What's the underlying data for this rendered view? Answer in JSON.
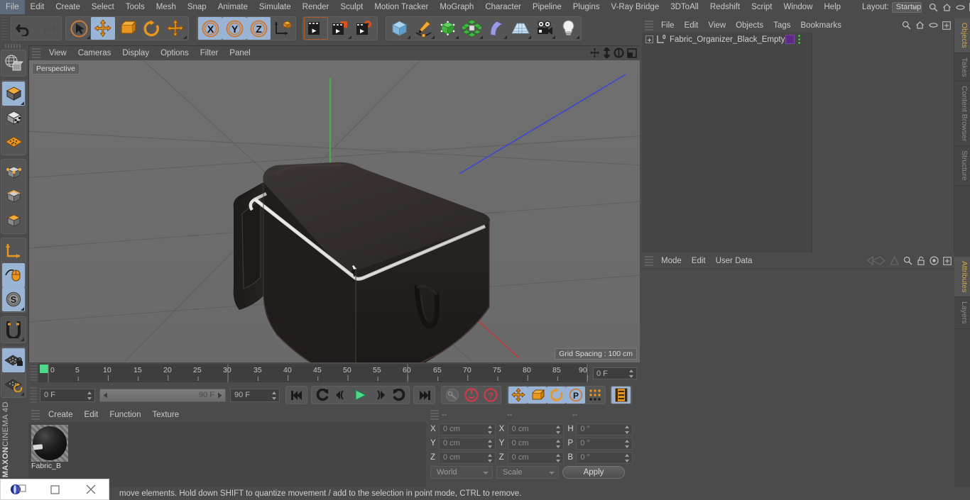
{
  "menubar": {
    "items": [
      "File",
      "Edit",
      "Create",
      "Select",
      "Tools",
      "Mesh",
      "Snap",
      "Animate",
      "Simulate",
      "Render",
      "Sculpt",
      "Motion Tracker",
      "MoGraph",
      "Character",
      "Pipeline",
      "Plugins",
      "V-Ray Bridge",
      "3DToAll",
      "Redshift",
      "Script",
      "Window",
      "Help"
    ],
    "layout_label": "Layout:",
    "layout_value": "Startup"
  },
  "toolbar": {
    "groups": [
      {
        "name": "history",
        "buttons": [
          {
            "name": "undo-button",
            "icon": "undo-icon",
            "active": false
          },
          {
            "name": "redo-button",
            "icon": "redo-icon",
            "active": false
          }
        ]
      },
      {
        "name": "transform",
        "buttons": [
          {
            "name": "live-selection-button",
            "icon": "cursor-select-icon",
            "active": false
          },
          {
            "name": "move-button",
            "icon": "move-icon",
            "active": true
          },
          {
            "name": "scale-button",
            "icon": "scale-icon",
            "active": false
          },
          {
            "name": "rotate-button",
            "icon": "rotate-icon",
            "active": false
          },
          {
            "name": "move-alt-button",
            "icon": "move-icon",
            "active": false
          }
        ]
      },
      {
        "name": "axis-lock",
        "buttons": [
          {
            "name": "axis-x-button",
            "icon": "x-axis-icon",
            "active": true
          },
          {
            "name": "axis-y-button",
            "icon": "y-axis-icon",
            "active": true
          },
          {
            "name": "axis-z-button",
            "icon": "z-axis-icon",
            "active": true
          },
          {
            "name": "world-object-coords-button",
            "icon": "world-coordinate-icon",
            "active": false
          }
        ]
      },
      {
        "name": "render",
        "buttons": [
          {
            "name": "render-view-button",
            "icon": "render-view-icon",
            "active": false
          },
          {
            "name": "render-to-picture-viewer-button",
            "icon": "render-picture-viewer-icon",
            "active": false
          },
          {
            "name": "render-settings-button",
            "icon": "render-settings-icon",
            "active": false
          }
        ]
      },
      {
        "name": "create",
        "buttons": [
          {
            "name": "add-cube-button",
            "icon": "cube-icon",
            "active": false
          },
          {
            "name": "add-spline-button",
            "icon": "pen-spline-icon",
            "active": false
          },
          {
            "name": "nurbs-button",
            "icon": "green-cube-icon",
            "active": false
          },
          {
            "name": "array-button",
            "icon": "green-cluster-icon",
            "active": false
          },
          {
            "name": "bend-deformer-button",
            "icon": "bend-deformer-icon",
            "active": false
          },
          {
            "name": "floor-environment-button",
            "icon": "floor-grid-icon",
            "active": false
          },
          {
            "name": "camera-button",
            "icon": "camera-icon",
            "active": false
          },
          {
            "name": "light-button",
            "icon": "light-bulb-icon",
            "active": false
          }
        ]
      }
    ]
  },
  "left_palette": {
    "groups": [
      {
        "buttons": [
          {
            "name": "undo-view-button",
            "icon": "globe-wire-icon",
            "active": false
          }
        ]
      },
      {
        "buttons": [
          {
            "name": "make-editable-button",
            "icon": "editable-cube-icon",
            "active": true
          },
          {
            "name": "model-mode-button",
            "icon": "checker-cube-icon",
            "active": false
          },
          {
            "name": "texture-mode-button",
            "icon": "texture-grid-icon",
            "active": false
          }
        ]
      },
      {
        "buttons": [
          {
            "name": "points-mode-button",
            "icon": "points-cube-icon",
            "active": false
          },
          {
            "name": "edges-mode-button",
            "icon": "edges-cube-icon",
            "active": false
          },
          {
            "name": "polygons-mode-button",
            "icon": "polygon-cube-icon",
            "active": false
          }
        ]
      },
      {
        "buttons": [
          {
            "name": "axis-mode-button",
            "icon": "axis-arrow-icon",
            "active": false
          },
          {
            "name": "enable-axis-button",
            "icon": "mouse-icon",
            "active": true
          },
          {
            "name": "soft-selection-button",
            "icon": "s-circle-icon",
            "active": true
          }
        ]
      },
      {
        "buttons": [
          {
            "name": "magnet-tool-button",
            "icon": "magnet-icon",
            "active": false
          }
        ]
      },
      {
        "buttons": [
          {
            "name": "lock-workplane-button",
            "icon": "workplane-lock-icon",
            "active": true
          },
          {
            "name": "rotate-workplane-button",
            "icon": "workplane-rotate-icon",
            "active": false
          }
        ]
      }
    ],
    "brand_bold": "MAXON",
    "brand_rest": "CINEMA 4D"
  },
  "viewport": {
    "menu_items": [
      "View",
      "Cameras",
      "Display",
      "Options",
      "Filter",
      "Panel"
    ],
    "corner_icons": [
      "pan-view-icon",
      "dolly-view-icon",
      "rotate-view-icon",
      "maximize-view-icon"
    ],
    "label": "Perspective",
    "grid_spacing": "Grid Spacing : 100 cm",
    "axis_gizmo": {
      "x": "X",
      "y": "Y",
      "z": "Z",
      "x_color": "#d44040",
      "y_color": "#4fc24f",
      "z_color": "#4a6fe0"
    },
    "scene_object": "fabric organizer black empty storage box"
  },
  "timeline": {
    "ticks": [
      "0",
      "5",
      "10",
      "15",
      "20",
      "25",
      "30",
      "35",
      "40",
      "45",
      "50",
      "55",
      "60",
      "65",
      "70",
      "75",
      "80",
      "85",
      "90"
    ],
    "start": 0,
    "end": 90,
    "playhead": 0,
    "current_frame_field": "0 F"
  },
  "playback": {
    "current_frame": "0 F",
    "range_start": "0 F",
    "range_end": "90 F",
    "max_frame": "90 F",
    "buttons": [
      {
        "name": "go-to-start-button",
        "icon": "skip-start-icon",
        "active": false
      },
      {
        "name": "previous-keyframe-button",
        "icon": "prev-key-icon",
        "active": false
      },
      {
        "name": "step-back-button",
        "icon": "step-back-icon",
        "active": false
      },
      {
        "name": "play-button",
        "icon": "play-icon",
        "active": false
      },
      {
        "name": "step-forward-button",
        "icon": "step-forward-icon",
        "active": false
      },
      {
        "name": "next-keyframe-button",
        "icon": "next-key-icon",
        "active": false
      },
      {
        "name": "go-to-end-button",
        "icon": "skip-end-icon",
        "active": false
      },
      {
        "name": "record-active-objects-button",
        "icon": "key-icon",
        "active": false
      },
      {
        "name": "autokeying-button",
        "icon": "record-circle-icon",
        "active": false
      },
      {
        "name": "keyframe-selection-button",
        "icon": "question-circle-icon",
        "active": false
      },
      {
        "name": "position-key-button",
        "icon": "move-icon",
        "active": true
      },
      {
        "name": "scale-key-button",
        "icon": "scale-icon",
        "active": true
      },
      {
        "name": "rotation-key-button",
        "icon": "rotate-icon",
        "active": true
      },
      {
        "name": "parameter-key-button",
        "icon": "p-circle-icon",
        "active": true
      },
      {
        "name": "point-level-animation-button",
        "icon": "dot-matrix-icon",
        "active": false
      },
      {
        "name": "timeline-view-button",
        "icon": "filmstrip-icon",
        "active": true
      }
    ]
  },
  "material_manager": {
    "menu_items": [
      "Create",
      "Edit",
      "Function",
      "Texture"
    ],
    "materials": [
      {
        "name": "Fabric_B"
      }
    ]
  },
  "coordinates": {
    "headers": [
      "--",
      "--",
      "--"
    ],
    "rows": [
      {
        "label1": "X",
        "value1": "0 cm",
        "label2": "X",
        "value2": "0 cm",
        "label3": "H",
        "value3": "0 °"
      },
      {
        "label1": "Y",
        "value1": "0 cm",
        "label2": "Y",
        "value2": "0 cm",
        "label3": "P",
        "value3": "0 °"
      },
      {
        "label1": "Z",
        "value1": "0 cm",
        "label2": "Z",
        "value2": "0 cm",
        "label3": "B",
        "value3": "0 °"
      }
    ],
    "system_select": "World",
    "mode_select": "Scale",
    "apply_label": "Apply"
  },
  "object_manager": {
    "menu_items": [
      "File",
      "Edit",
      "View",
      "Objects",
      "Tags",
      "Bookmarks"
    ],
    "icons": [
      "search-icon",
      "home-icon",
      "ellipse-icon",
      "plus-box-icon"
    ],
    "objects": [
      {
        "name": "Fabric_Organizer_Black_Empty",
        "layer_badge": "0",
        "material_color": "#5d2a86"
      }
    ]
  },
  "attributes_manager": {
    "menu_items": [
      "Mode",
      "Edit",
      "User Data"
    ],
    "icons": [
      "back-nav-icon",
      "up-nav-icon",
      "search-icon",
      "lock-icon",
      "target-icon",
      "plus-box-icon"
    ]
  },
  "right_tabs": [
    {
      "label": "Objects",
      "active": true
    },
    {
      "label": "Takes",
      "active": false
    },
    {
      "label": "Content Browser",
      "active": false
    },
    {
      "label": "Structure",
      "active": false
    },
    {
      "label": "Attributes",
      "active": true
    },
    {
      "label": "Layers",
      "active": false
    }
  ],
  "statusbar": {
    "message": "move elements. Hold down SHIFT to quantize movement / add to the selection in point mode, CTRL to remove."
  },
  "taskbar_popup": {
    "buttons": [
      {
        "name": "app-restore-icon",
        "glyph": "restore"
      },
      {
        "name": "maximize-icon",
        "glyph": "maximize"
      },
      {
        "name": "close-icon",
        "glyph": "close"
      }
    ]
  },
  "colors": {
    "panel_bg": "#4b4b4b",
    "field_bg": "#3e3e3e",
    "accent_orange": "#d9a441",
    "active_blue": "#9ab4d6",
    "viewport_bg": "#6e6e6e"
  }
}
